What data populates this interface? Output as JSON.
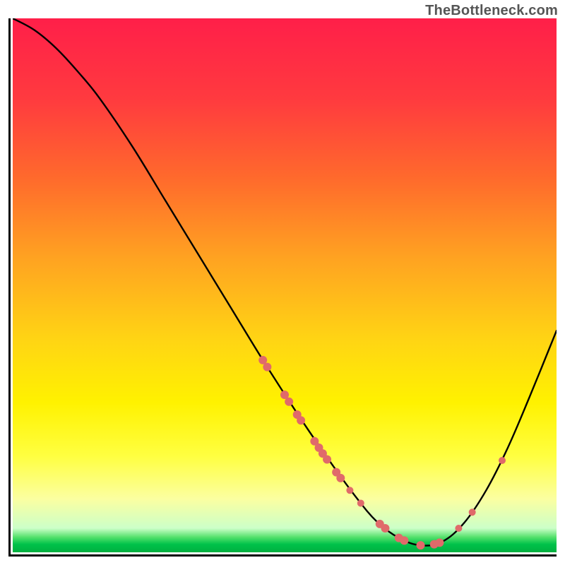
{
  "watermark": "TheBottleneck.com",
  "chart_data": {
    "type": "line",
    "title": "",
    "xlabel": "",
    "ylabel": "",
    "xlim": [
      0,
      100
    ],
    "ylim": [
      0,
      100
    ],
    "grid": false,
    "gradient_stops": [
      {
        "offset": 0.0,
        "color": "#ff1f49"
      },
      {
        "offset": 0.15,
        "color": "#ff3a3f"
      },
      {
        "offset": 0.3,
        "color": "#ff6a2c"
      },
      {
        "offset": 0.45,
        "color": "#ffa321"
      },
      {
        "offset": 0.6,
        "color": "#ffd414"
      },
      {
        "offset": 0.72,
        "color": "#fff200"
      },
      {
        "offset": 0.82,
        "color": "#ffff41"
      },
      {
        "offset": 0.9,
        "color": "#fbffa1"
      },
      {
        "offset": 0.955,
        "color": "#ccffc8"
      },
      {
        "offset": 0.972,
        "color": "#52e06a"
      },
      {
        "offset": 0.985,
        "color": "#00c24a"
      },
      {
        "offset": 1.0,
        "color": "#00b040"
      }
    ],
    "curve": [
      {
        "x": 0.0,
        "y": 100.0
      },
      {
        "x": 4.0,
        "y": 97.8
      },
      {
        "x": 8.0,
        "y": 94.4
      },
      {
        "x": 12.0,
        "y": 90.0
      },
      {
        "x": 16.0,
        "y": 85.0
      },
      {
        "x": 22.0,
        "y": 76.0
      },
      {
        "x": 28.0,
        "y": 66.0
      },
      {
        "x": 34.0,
        "y": 56.0
      },
      {
        "x": 40.0,
        "y": 46.0
      },
      {
        "x": 46.0,
        "y": 36.0
      },
      {
        "x": 52.0,
        "y": 26.5
      },
      {
        "x": 58.0,
        "y": 17.5
      },
      {
        "x": 63.0,
        "y": 10.5
      },
      {
        "x": 67.0,
        "y": 5.7
      },
      {
        "x": 71.0,
        "y": 2.7
      },
      {
        "x": 75.0,
        "y": 1.3
      },
      {
        "x": 79.0,
        "y": 2.0
      },
      {
        "x": 83.0,
        "y": 5.5
      },
      {
        "x": 87.0,
        "y": 11.5
      },
      {
        "x": 91.0,
        "y": 19.5
      },
      {
        "x": 95.0,
        "y": 29.0
      },
      {
        "x": 100.0,
        "y": 41.5
      }
    ],
    "markers": [
      {
        "x": 46.0,
        "y": 36.0,
        "r": 6
      },
      {
        "x": 46.8,
        "y": 34.7,
        "r": 6
      },
      {
        "x": 50.0,
        "y": 29.5,
        "r": 6
      },
      {
        "x": 50.8,
        "y": 28.2,
        "r": 6
      },
      {
        "x": 52.3,
        "y": 25.8,
        "r": 6
      },
      {
        "x": 53.0,
        "y": 24.7,
        "r": 6
      },
      {
        "x": 55.5,
        "y": 20.8,
        "r": 6
      },
      {
        "x": 56.3,
        "y": 19.6,
        "r": 6
      },
      {
        "x": 57.0,
        "y": 18.5,
        "r": 6
      },
      {
        "x": 57.8,
        "y": 17.4,
        "r": 6
      },
      {
        "x": 59.5,
        "y": 15.0,
        "r": 6
      },
      {
        "x": 60.3,
        "y": 13.9,
        "r": 6
      },
      {
        "x": 62.0,
        "y": 11.6,
        "r": 5
      },
      {
        "x": 64.0,
        "y": 9.2,
        "r": 5
      },
      {
        "x": 67.5,
        "y": 5.3,
        "r": 6
      },
      {
        "x": 68.5,
        "y": 4.5,
        "r": 6
      },
      {
        "x": 71.0,
        "y": 2.7,
        "r": 6
      },
      {
        "x": 72.0,
        "y": 2.2,
        "r": 6
      },
      {
        "x": 75.0,
        "y": 1.3,
        "r": 6
      },
      {
        "x": 77.5,
        "y": 1.5,
        "r": 6
      },
      {
        "x": 78.5,
        "y": 1.8,
        "r": 6
      },
      {
        "x": 82.0,
        "y": 4.5,
        "r": 5
      },
      {
        "x": 84.5,
        "y": 7.5,
        "r": 5
      },
      {
        "x": 90.0,
        "y": 17.2,
        "r": 5
      }
    ],
    "marker_color": "#e06a6a"
  }
}
